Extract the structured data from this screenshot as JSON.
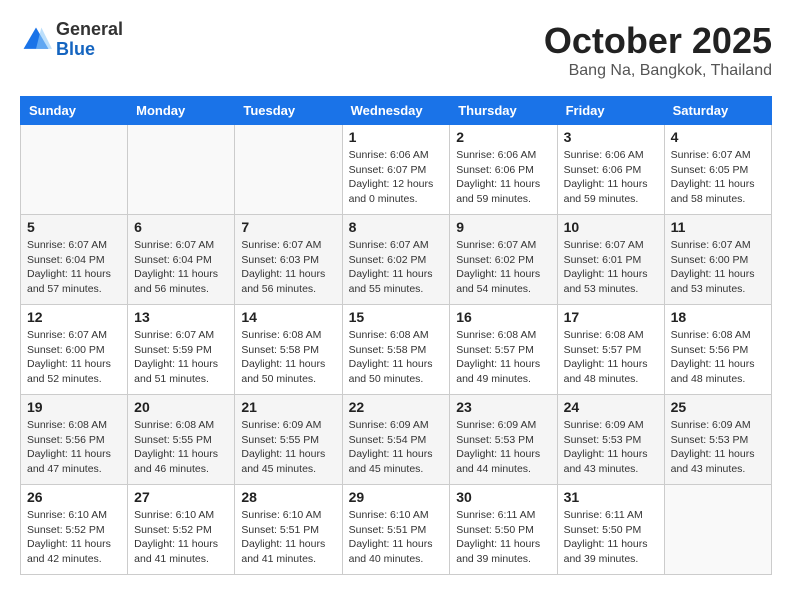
{
  "header": {
    "logo_general": "General",
    "logo_blue": "Blue",
    "month_year": "October 2025",
    "location": "Bang Na, Bangkok, Thailand"
  },
  "days_of_week": [
    "Sunday",
    "Monday",
    "Tuesday",
    "Wednesday",
    "Thursday",
    "Friday",
    "Saturday"
  ],
  "weeks": [
    [
      {
        "day": "",
        "info": ""
      },
      {
        "day": "",
        "info": ""
      },
      {
        "day": "",
        "info": ""
      },
      {
        "day": "1",
        "info": "Sunrise: 6:06 AM\nSunset: 6:07 PM\nDaylight: 12 hours\nand 0 minutes."
      },
      {
        "day": "2",
        "info": "Sunrise: 6:06 AM\nSunset: 6:06 PM\nDaylight: 11 hours\nand 59 minutes."
      },
      {
        "day": "3",
        "info": "Sunrise: 6:06 AM\nSunset: 6:06 PM\nDaylight: 11 hours\nand 59 minutes."
      },
      {
        "day": "4",
        "info": "Sunrise: 6:07 AM\nSunset: 6:05 PM\nDaylight: 11 hours\nand 58 minutes."
      }
    ],
    [
      {
        "day": "5",
        "info": "Sunrise: 6:07 AM\nSunset: 6:04 PM\nDaylight: 11 hours\nand 57 minutes."
      },
      {
        "day": "6",
        "info": "Sunrise: 6:07 AM\nSunset: 6:04 PM\nDaylight: 11 hours\nand 56 minutes."
      },
      {
        "day": "7",
        "info": "Sunrise: 6:07 AM\nSunset: 6:03 PM\nDaylight: 11 hours\nand 56 minutes."
      },
      {
        "day": "8",
        "info": "Sunrise: 6:07 AM\nSunset: 6:02 PM\nDaylight: 11 hours\nand 55 minutes."
      },
      {
        "day": "9",
        "info": "Sunrise: 6:07 AM\nSunset: 6:02 PM\nDaylight: 11 hours\nand 54 minutes."
      },
      {
        "day": "10",
        "info": "Sunrise: 6:07 AM\nSunset: 6:01 PM\nDaylight: 11 hours\nand 53 minutes."
      },
      {
        "day": "11",
        "info": "Sunrise: 6:07 AM\nSunset: 6:00 PM\nDaylight: 11 hours\nand 53 minutes."
      }
    ],
    [
      {
        "day": "12",
        "info": "Sunrise: 6:07 AM\nSunset: 6:00 PM\nDaylight: 11 hours\nand 52 minutes."
      },
      {
        "day": "13",
        "info": "Sunrise: 6:07 AM\nSunset: 5:59 PM\nDaylight: 11 hours\nand 51 minutes."
      },
      {
        "day": "14",
        "info": "Sunrise: 6:08 AM\nSunset: 5:58 PM\nDaylight: 11 hours\nand 50 minutes."
      },
      {
        "day": "15",
        "info": "Sunrise: 6:08 AM\nSunset: 5:58 PM\nDaylight: 11 hours\nand 50 minutes."
      },
      {
        "day": "16",
        "info": "Sunrise: 6:08 AM\nSunset: 5:57 PM\nDaylight: 11 hours\nand 49 minutes."
      },
      {
        "day": "17",
        "info": "Sunrise: 6:08 AM\nSunset: 5:57 PM\nDaylight: 11 hours\nand 48 minutes."
      },
      {
        "day": "18",
        "info": "Sunrise: 6:08 AM\nSunset: 5:56 PM\nDaylight: 11 hours\nand 48 minutes."
      }
    ],
    [
      {
        "day": "19",
        "info": "Sunrise: 6:08 AM\nSunset: 5:56 PM\nDaylight: 11 hours\nand 47 minutes."
      },
      {
        "day": "20",
        "info": "Sunrise: 6:08 AM\nSunset: 5:55 PM\nDaylight: 11 hours\nand 46 minutes."
      },
      {
        "day": "21",
        "info": "Sunrise: 6:09 AM\nSunset: 5:55 PM\nDaylight: 11 hours\nand 45 minutes."
      },
      {
        "day": "22",
        "info": "Sunrise: 6:09 AM\nSunset: 5:54 PM\nDaylight: 11 hours\nand 45 minutes."
      },
      {
        "day": "23",
        "info": "Sunrise: 6:09 AM\nSunset: 5:53 PM\nDaylight: 11 hours\nand 44 minutes."
      },
      {
        "day": "24",
        "info": "Sunrise: 6:09 AM\nSunset: 5:53 PM\nDaylight: 11 hours\nand 43 minutes."
      },
      {
        "day": "25",
        "info": "Sunrise: 6:09 AM\nSunset: 5:53 PM\nDaylight: 11 hours\nand 43 minutes."
      }
    ],
    [
      {
        "day": "26",
        "info": "Sunrise: 6:10 AM\nSunset: 5:52 PM\nDaylight: 11 hours\nand 42 minutes."
      },
      {
        "day": "27",
        "info": "Sunrise: 6:10 AM\nSunset: 5:52 PM\nDaylight: 11 hours\nand 41 minutes."
      },
      {
        "day": "28",
        "info": "Sunrise: 6:10 AM\nSunset: 5:51 PM\nDaylight: 11 hours\nand 41 minutes."
      },
      {
        "day": "29",
        "info": "Sunrise: 6:10 AM\nSunset: 5:51 PM\nDaylight: 11 hours\nand 40 minutes."
      },
      {
        "day": "30",
        "info": "Sunrise: 6:11 AM\nSunset: 5:50 PM\nDaylight: 11 hours\nand 39 minutes."
      },
      {
        "day": "31",
        "info": "Sunrise: 6:11 AM\nSunset: 5:50 PM\nDaylight: 11 hours\nand 39 minutes."
      },
      {
        "day": "",
        "info": ""
      }
    ]
  ]
}
